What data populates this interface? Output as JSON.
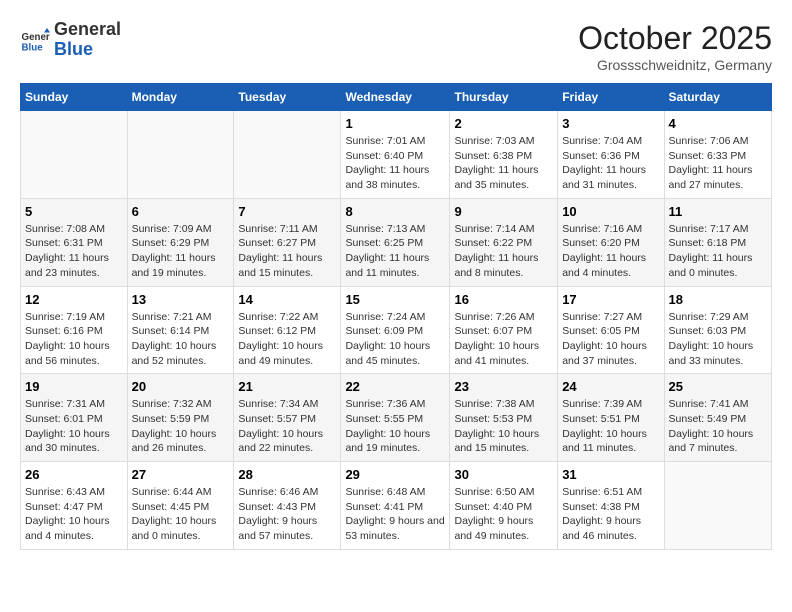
{
  "header": {
    "logo_line1": "General",
    "logo_line2": "Blue",
    "month": "October 2025",
    "location": "Grossschweidnitz, Germany"
  },
  "days_of_week": [
    "Sunday",
    "Monday",
    "Tuesday",
    "Wednesday",
    "Thursday",
    "Friday",
    "Saturday"
  ],
  "weeks": [
    [
      {
        "num": "",
        "info": ""
      },
      {
        "num": "",
        "info": ""
      },
      {
        "num": "",
        "info": ""
      },
      {
        "num": "1",
        "info": "Sunrise: 7:01 AM\nSunset: 6:40 PM\nDaylight: 11 hours and 38 minutes."
      },
      {
        "num": "2",
        "info": "Sunrise: 7:03 AM\nSunset: 6:38 PM\nDaylight: 11 hours and 35 minutes."
      },
      {
        "num": "3",
        "info": "Sunrise: 7:04 AM\nSunset: 6:36 PM\nDaylight: 11 hours and 31 minutes."
      },
      {
        "num": "4",
        "info": "Sunrise: 7:06 AM\nSunset: 6:33 PM\nDaylight: 11 hours and 27 minutes."
      }
    ],
    [
      {
        "num": "5",
        "info": "Sunrise: 7:08 AM\nSunset: 6:31 PM\nDaylight: 11 hours and 23 minutes."
      },
      {
        "num": "6",
        "info": "Sunrise: 7:09 AM\nSunset: 6:29 PM\nDaylight: 11 hours and 19 minutes."
      },
      {
        "num": "7",
        "info": "Sunrise: 7:11 AM\nSunset: 6:27 PM\nDaylight: 11 hours and 15 minutes."
      },
      {
        "num": "8",
        "info": "Sunrise: 7:13 AM\nSunset: 6:25 PM\nDaylight: 11 hours and 11 minutes."
      },
      {
        "num": "9",
        "info": "Sunrise: 7:14 AM\nSunset: 6:22 PM\nDaylight: 11 hours and 8 minutes."
      },
      {
        "num": "10",
        "info": "Sunrise: 7:16 AM\nSunset: 6:20 PM\nDaylight: 11 hours and 4 minutes."
      },
      {
        "num": "11",
        "info": "Sunrise: 7:17 AM\nSunset: 6:18 PM\nDaylight: 11 hours and 0 minutes."
      }
    ],
    [
      {
        "num": "12",
        "info": "Sunrise: 7:19 AM\nSunset: 6:16 PM\nDaylight: 10 hours and 56 minutes."
      },
      {
        "num": "13",
        "info": "Sunrise: 7:21 AM\nSunset: 6:14 PM\nDaylight: 10 hours and 52 minutes."
      },
      {
        "num": "14",
        "info": "Sunrise: 7:22 AM\nSunset: 6:12 PM\nDaylight: 10 hours and 49 minutes."
      },
      {
        "num": "15",
        "info": "Sunrise: 7:24 AM\nSunset: 6:09 PM\nDaylight: 10 hours and 45 minutes."
      },
      {
        "num": "16",
        "info": "Sunrise: 7:26 AM\nSunset: 6:07 PM\nDaylight: 10 hours and 41 minutes."
      },
      {
        "num": "17",
        "info": "Sunrise: 7:27 AM\nSunset: 6:05 PM\nDaylight: 10 hours and 37 minutes."
      },
      {
        "num": "18",
        "info": "Sunrise: 7:29 AM\nSunset: 6:03 PM\nDaylight: 10 hours and 33 minutes."
      }
    ],
    [
      {
        "num": "19",
        "info": "Sunrise: 7:31 AM\nSunset: 6:01 PM\nDaylight: 10 hours and 30 minutes."
      },
      {
        "num": "20",
        "info": "Sunrise: 7:32 AM\nSunset: 5:59 PM\nDaylight: 10 hours and 26 minutes."
      },
      {
        "num": "21",
        "info": "Sunrise: 7:34 AM\nSunset: 5:57 PM\nDaylight: 10 hours and 22 minutes."
      },
      {
        "num": "22",
        "info": "Sunrise: 7:36 AM\nSunset: 5:55 PM\nDaylight: 10 hours and 19 minutes."
      },
      {
        "num": "23",
        "info": "Sunrise: 7:38 AM\nSunset: 5:53 PM\nDaylight: 10 hours and 15 minutes."
      },
      {
        "num": "24",
        "info": "Sunrise: 7:39 AM\nSunset: 5:51 PM\nDaylight: 10 hours and 11 minutes."
      },
      {
        "num": "25",
        "info": "Sunrise: 7:41 AM\nSunset: 5:49 PM\nDaylight: 10 hours and 7 minutes."
      }
    ],
    [
      {
        "num": "26",
        "info": "Sunrise: 6:43 AM\nSunset: 4:47 PM\nDaylight: 10 hours and 4 minutes."
      },
      {
        "num": "27",
        "info": "Sunrise: 6:44 AM\nSunset: 4:45 PM\nDaylight: 10 hours and 0 minutes."
      },
      {
        "num": "28",
        "info": "Sunrise: 6:46 AM\nSunset: 4:43 PM\nDaylight: 9 hours and 57 minutes."
      },
      {
        "num": "29",
        "info": "Sunrise: 6:48 AM\nSunset: 4:41 PM\nDaylight: 9 hours and 53 minutes."
      },
      {
        "num": "30",
        "info": "Sunrise: 6:50 AM\nSunset: 4:40 PM\nDaylight: 9 hours and 49 minutes."
      },
      {
        "num": "31",
        "info": "Sunrise: 6:51 AM\nSunset: 4:38 PM\nDaylight: 9 hours and 46 minutes."
      },
      {
        "num": "",
        "info": ""
      }
    ]
  ]
}
